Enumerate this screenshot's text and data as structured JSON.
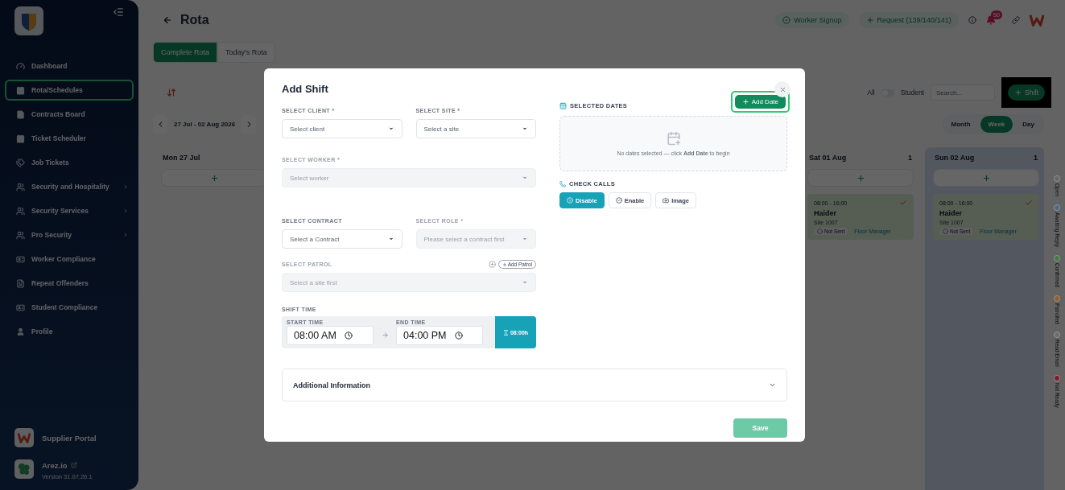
{
  "sidebar": {
    "items": [
      {
        "label": "Dashboard",
        "selected": false,
        "submenu": false
      },
      {
        "label": "Rota/Schedules",
        "selected": true,
        "submenu": false
      },
      {
        "label": "Contracts Board",
        "selected": false,
        "submenu": false
      },
      {
        "label": "Ticket Scheduler",
        "selected": false,
        "submenu": false
      },
      {
        "label": "Job Tickets",
        "selected": false,
        "submenu": false
      },
      {
        "label": "Security and Hospitality",
        "selected": false,
        "submenu": true
      },
      {
        "label": "Security Services",
        "selected": false,
        "submenu": true
      },
      {
        "label": "Pro Security",
        "selected": false,
        "submenu": true
      },
      {
        "label": "Worker Compliance",
        "selected": false,
        "submenu": false
      },
      {
        "label": "Repeat Offenders",
        "selected": false,
        "submenu": false
      },
      {
        "label": "Student Compliance",
        "selected": false,
        "submenu": false
      },
      {
        "label": "Profile",
        "selected": false,
        "submenu": false
      }
    ],
    "portal": {
      "label": "Supplier Portal"
    },
    "brand": {
      "label": "Arez.io",
      "version": "Version 31.07.26.1"
    }
  },
  "header": {
    "title": "Rota",
    "actions": [
      {
        "label": "Worker Signup",
        "kind": "check"
      },
      {
        "label": "Request (139/140/141)",
        "kind": "plus"
      }
    ],
    "notification_count": "50"
  },
  "tabs": [
    {
      "label": "Complete Rota",
      "selected": true
    },
    {
      "label": "Today's Rota",
      "selected": false
    }
  ],
  "filters": {
    "left_label": "All",
    "right_label": "Student",
    "on": false,
    "search_placeholder": "Search...",
    "add_label": "Shift",
    "add_highlighted": true
  },
  "date_range": "27 Jul - 02 Aug 2026",
  "views": [
    {
      "label": "Month",
      "selected": false
    },
    {
      "label": "Week",
      "selected": true
    },
    {
      "label": "Day",
      "selected": false
    }
  ],
  "days": [
    {
      "label": "Mon 27 Jul",
      "today": false
    },
    {
      "label": "Sat 01 Aug",
      "count": "1",
      "today": false,
      "shifts": [
        {
          "time": "08:00 - 16:00",
          "worker": "Haider",
          "site": "Site 1007",
          "status": "Not Sent",
          "role": "Floor Manager",
          "confirmed": true
        }
      ]
    },
    {
      "label": "Sun 02 Aug",
      "count": "1",
      "today": true,
      "shifts": [
        {
          "time": "08:00 - 16:00",
          "worker": "Haider",
          "site": "Site 1007",
          "status": "Not Sent",
          "role": "Floor Manager",
          "confirmed": true
        }
      ]
    }
  ],
  "legend": [
    {
      "label": "Open",
      "color": "#666666"
    },
    {
      "label": "Awaiting Reply",
      "color": "#4a6a8a"
    },
    {
      "label": "Confirmed",
      "color": "#3f7a3f"
    },
    {
      "label": "Patrolled",
      "color": "#a35a1e"
    },
    {
      "label": "Read Email",
      "color": "#6e6e6e"
    },
    {
      "label": "Not Ready",
      "color": "#8c1420"
    }
  ],
  "modal": {
    "title": "Add Shift",
    "field_rows": [
      [
        {
          "label": "SELECT CLIENT *",
          "placeholder": "Select client",
          "disabled": false
        },
        {
          "label": "SELECT SITE *",
          "placeholder": "Select a site",
          "disabled": false
        }
      ],
      [
        {
          "label": "SELECT WORKER *",
          "placeholder": "Select worker",
          "disabled": true
        }
      ],
      [
        {
          "label": "SELECT CONTRACT",
          "placeholder": "Select a Contract",
          "disabled": false
        },
        {
          "label": "SELECT ROLE *",
          "placeholder": "Please select a contract first",
          "disabled": true
        }
      ],
      [
        {
          "label": "SELECT PATROL",
          "placeholder": "Select a site first",
          "disabled": true,
          "action": "Add Patrol"
        }
      ]
    ],
    "shift_time": {
      "label": "SHIFT TIME",
      "start_label": "START TIME",
      "start": "08:00 AM",
      "end_label": "END TIME",
      "end": "04:00 PM",
      "duration": "08:00h"
    },
    "dates": {
      "label": "SELECTED DATES",
      "add_label": "Add Date",
      "add_highlighted": true,
      "empty_text": "No dates selected — click **Add Date** to begin"
    },
    "check_calls": {
      "label": "CHECK CALLS",
      "options": [
        {
          "label": "Disable",
          "selected": true
        },
        {
          "label": "Enable",
          "selected": false
        },
        {
          "label": "Image",
          "selected": false
        }
      ]
    },
    "additional": {
      "label": "Additional Information",
      "expanded": false
    },
    "save": {
      "label": "Save",
      "disabled": true
    }
  }
}
